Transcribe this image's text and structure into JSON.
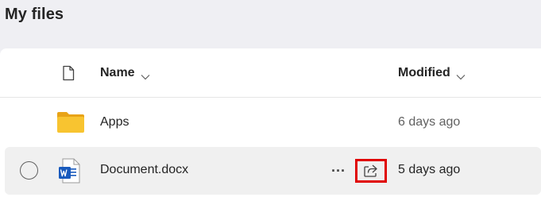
{
  "page": {
    "title": "My files"
  },
  "header": {
    "type_icon": "file-icon",
    "name_label": "Name",
    "modified_label": "Modified"
  },
  "rows": [
    {
      "icon": "folder-icon",
      "name": "Apps",
      "modified": "6 days ago"
    },
    {
      "icon": "word-document-icon",
      "name": "Document.docx",
      "modified": "5 days ago",
      "more_label": "···",
      "share_icon": "share-icon"
    }
  ],
  "colors": {
    "background": "#efeff3",
    "panel": "#ffffff",
    "selected_row": "#f0f0f0",
    "highlight_box": "#e00000",
    "folder": "#f8c430",
    "word_blue": "#185abd"
  }
}
